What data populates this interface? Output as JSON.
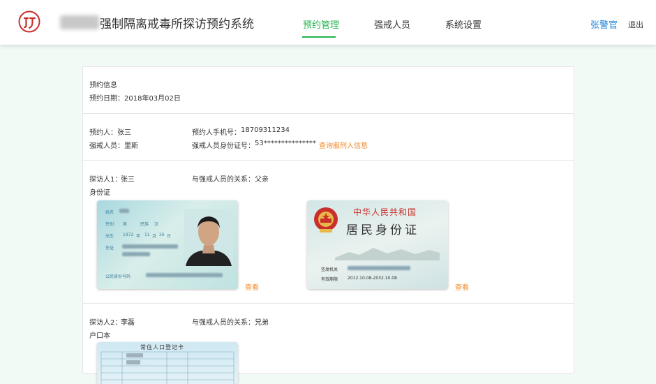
{
  "header": {
    "app_title": "强制隔离戒毒所探访预约系统",
    "nav": [
      {
        "label": "预约管理",
        "active": true
      },
      {
        "label": "强戒人员",
        "active": false
      },
      {
        "label": "系统设置",
        "active": false
      }
    ],
    "user_name": "张警官",
    "logout_label": "退出",
    "accent_color": "#22b24c",
    "user_color": "#1d84d8"
  },
  "appointment": {
    "section_title": "预约信息",
    "date_label": "预约日期：",
    "date_value": "2018年03月02日"
  },
  "booker": {
    "name_label": "预约人：",
    "name_value": "张三",
    "phone_label": "预约人手机号：",
    "phone_value": "18709311234",
    "inmate_label": "强戒人员：",
    "inmate_value": "里斯",
    "inmate_id_label": "强戒人员身份证号：",
    "inmate_id_value": "53***************",
    "query_link": "查询服刑人信息",
    "link_color": "#f08a2a"
  },
  "visitors": [
    {
      "label": "探访人1：",
      "name": "张三",
      "relation_label": "与强戒人员的关系：",
      "relation": "父亲",
      "doc_type": "身份证",
      "view_label_front": "查看",
      "view_label_back": "查看",
      "id_front": {
        "name_label": "姓名",
        "gender_label": "性别",
        "gender_value": "男",
        "ethnic_label": "民族",
        "ethnic_value": "汉",
        "birth_label": "出生",
        "birth_year": "1972",
        "birth_year_unit": "年",
        "birth_month": "11",
        "birth_month_unit": "月",
        "birth_day": "26",
        "birth_day_unit": "日",
        "address_label": "住址",
        "id_number_label": "公民身份号码"
      },
      "id_back": {
        "country_title": "中华人民共和国",
        "card_title": "居民身份证",
        "authority_label": "签发机关",
        "validity_label": "有效期限",
        "validity_value": "2012.10.08-2032.10.08"
      }
    },
    {
      "label": "探访人2：",
      "name": "李磊",
      "relation_label": "与强戒人员的关系：",
      "relation": "兄弟",
      "doc_type": "户口本",
      "hukou_title": "常住人口登记卡"
    }
  ]
}
